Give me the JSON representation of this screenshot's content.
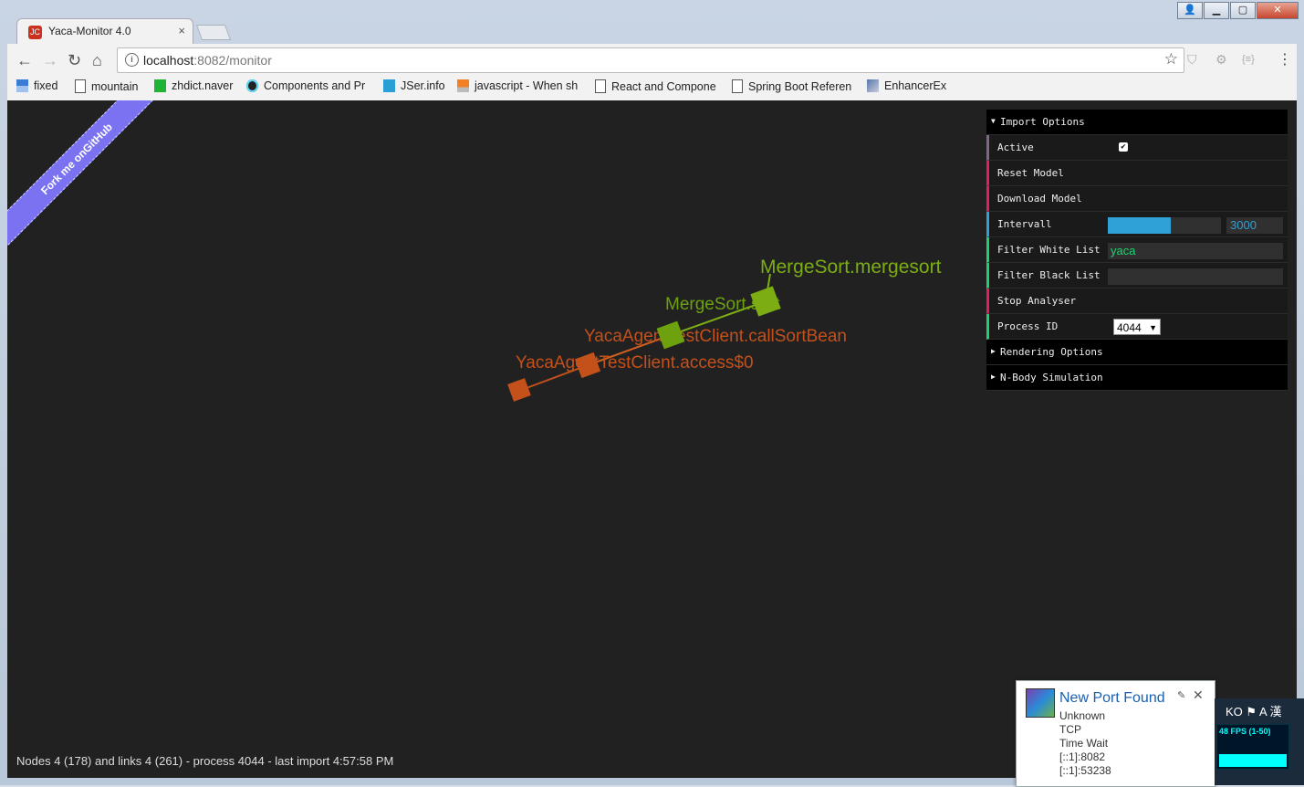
{
  "window": {
    "minimize": "▁",
    "maximize": "▢",
    "close": "✕",
    "user": "👤"
  },
  "tab": {
    "title": "Yaca-Monitor 4.0",
    "close": "×",
    "favicon_text": "JC"
  },
  "nav": {
    "back": "←",
    "forward": "→",
    "reload": "↻",
    "home": "⌂"
  },
  "address": {
    "host": "localhost",
    "rest": ":8082/monitor",
    "info": "i",
    "star": "☆"
  },
  "extensions": [
    "⛉",
    "⚙",
    "{≡}",
    "⋮"
  ],
  "bookmarks": [
    {
      "label": "fixed",
      "icon": "fixed-icon"
    },
    {
      "label": "mountain",
      "icon": "page-icon"
    },
    {
      "label": "zhdict.naver",
      "icon": "dict-icon"
    },
    {
      "label": "Components and Pr",
      "icon": "react-icon"
    },
    {
      "label": "JSer.info",
      "icon": "jser-icon"
    },
    {
      "label": "javascript - When sh",
      "icon": "stackoverflow-icon"
    },
    {
      "label": "React and Compone",
      "icon": "page-icon"
    },
    {
      "label": "Spring Boot Referen",
      "icon": "page-icon"
    },
    {
      "label": "EnhancerEx",
      "icon": "enhancer-icon"
    }
  ],
  "ribbon": "Fork me onGitHub",
  "graph": {
    "nodes": [
      {
        "label": "",
        "color": "#c4501a"
      },
      {
        "label": "YacaAgentTestClient.access$0",
        "color": "#c4501a"
      },
      {
        "label": "YacaAgentTestClient.callSortBean",
        "color": "#c4501a"
      },
      {
        "label": "MergeSort.sort",
        "color": "#6ea10e"
      },
      {
        "label": "MergeSort.mergesort",
        "color": "#7cae14"
      }
    ]
  },
  "panel": {
    "import_options": "Import Options",
    "active": "Active",
    "active_checked": "✔",
    "reset_model": "Reset Model",
    "download_model": "Download Model",
    "intervall": "Intervall",
    "intervall_value": "3000",
    "intervall_fraction": 0.56,
    "filter_white": "Filter White List",
    "filter_white_value": "yaca",
    "filter_black": "Filter Black List",
    "filter_black_value": "",
    "stop_analyser": "Stop Analyser",
    "process_id": "Process ID",
    "process_id_value": "4044",
    "rendering_options": "Rendering Options",
    "nbody": "N-Body Simulation"
  },
  "status": "Nodes 4 (178) and links 4 (261) - process 4044 - last import 4:57:58 PM",
  "notification": {
    "title": "New Port Found",
    "lines": [
      "Unknown",
      "TCP",
      "Time Wait",
      "[::1]:8082",
      "[::1]:53238"
    ]
  },
  "tray": {
    "ime": "KO ⚑ A 漢",
    "fps": "48 FPS (1-50)"
  }
}
